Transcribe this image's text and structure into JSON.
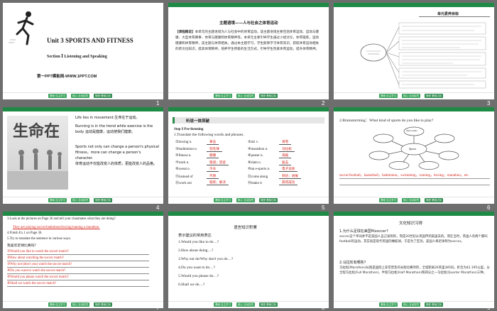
{
  "nav": {
    "pill1": "基础·自主学习",
    "pill2": "核心·互动探究",
    "pill3": "随堂·基础达标"
  },
  "slides": [
    {
      "num": "1",
      "unit": "Unit 3    SPORTS AND FITNESS",
      "section": "Section  Ⅰ   Listening and Speaking",
      "footer": "第一PPT模板网-WWW.1PPT.COM"
    },
    {
      "num": "2",
      "theme": "主题语境——人与社会之体育运动",
      "intro_label": "【课程概说】",
      "intro_text": "本单元的主题语境为人与社会中的体育运动。该主题语境主要包括体育运动、运动与健康、大型体育赛事、体育与健康和体育精神等。本单元主要引导学生通过小组讨论，体育锻炼，运动健康和体育精神，该主题与体育相关。通过本主题学习，学生能够学习体育常识，获取体育运动相关的跨文化知识，提高体育精神，培养学生积极的生活方式，引导学生热爱体育运动，提升体育精神。"
    },
    {
      "num": "3",
      "box_title": "单元素养目标"
    },
    {
      "num": "4",
      "cn_title": "生命在",
      "lines": [
        "Life lies in movement.生命在于运动。",
        "Running is in the trend while exercise is the body 运动是健康，运动使我们健康。",
        "Sports not only can change a person's physical fitness，more can change a person's character.",
        "体育运动不仅能改变人的体质，更能改变人的品格。"
      ]
    },
    {
      "num": "5",
      "header": "听说一体突破",
      "step": "Step  Ⅰ    Pre-listening",
      "instruction": "1.Translate the following words and phrases.",
      "left_items": [
        {
          "en": "①boxing n.",
          "cn": "拳击"
        },
        {
          "en": "③badminton n.",
          "cn": "羽毛球"
        },
        {
          "en": "⑤fitness n.",
          "cn": "健康"
        },
        {
          "en": "⑦track n.",
          "cn": "跑道；足迹"
        },
        {
          "en": "⑨sweat n.",
          "cn": "汗水"
        },
        {
          "en": "⑪instead of",
          "cn": "代替"
        },
        {
          "en": "⑬work out",
          "cn": "锻炼；解决"
        }
      ],
      "right_items": [
        {
          "en": "②ski v.",
          "cn": "滑雪"
        },
        {
          "en": "④marathon n.",
          "cn": "马拉松"
        },
        {
          "en": "⑥poster n.",
          "cn": "海报"
        },
        {
          "en": "⑧slam n.",
          "cn": "猛击"
        },
        {
          "en": "⑩an e-sports n.",
          "cn": "电子竞技"
        },
        {
          "en": "⑫come along",
          "cn": "到达；进展"
        },
        {
          "en": "⑭make it",
          "cn": "获得成功"
        }
      ]
    },
    {
      "num": "6",
      "question": "2.Brainstorming：What kind of sports do you like to play?",
      "center_label": "Sports",
      "top_label": "table tennis",
      "answer": "soccer/football，basketball，badminton，swimming，running，boxing，marathon，etc."
    },
    {
      "num": "7",
      "q3": "3.Look at the pictures on Page 36 and tell your classmates what they are doing?",
      "a3": "They are playing soccer/badminton/boxing/running a marathon.",
      "q4": "4.Finish Ex.1 on Page 36.",
      "q5": "5.Try to translate the sentence in various ways.",
      "prompt": "我喜欢足球比赛吗？",
      "options": [
        "①Would you like to watch the soccer match?",
        "②How about watching the soccer match?",
        "③Why not (don't you) watch the soccer match?",
        "④Do you want to watch the soccer match?",
        "⑤Would you please watch the soccer match?",
        "⑥Shall we watch the soccer match?"
      ]
    },
    {
      "num": "8",
      "title": "语言知识积累",
      "subtitle": "表示建议的常用表达",
      "items": [
        "1.Would you like to do…?",
        "2.How about doing…?",
        "3.Why not do/Why don't you do…?",
        "4.Do you want to do…?",
        "5.Would you please do…?",
        "6.Shall we do…?"
      ]
    },
    {
      "num": "9",
      "title": "文化知识习得",
      "q1": "1.为什么足球在美国叫soccer?",
      "a1": "soccer这个单词并不是美国人自己发明的，而是20世纪从英国传到美国去的。而在当时，英国人有两个都叫football的运动，其实就是现代英国的橄榄球。于是为了区别，美国人将足球称为soccer。",
      "q2": "2.马拉松有哪些？",
      "a2": "马拉松(Marathon)长跑是国际上非常普及的长跑比赛项目，全程距离26英里385码，折合为42.195公里，分全程马拉松(Full Marathon)、半程马拉松(Half Marathon)和四分之一马拉松(Quarter Marathon)三种。"
    }
  ]
}
